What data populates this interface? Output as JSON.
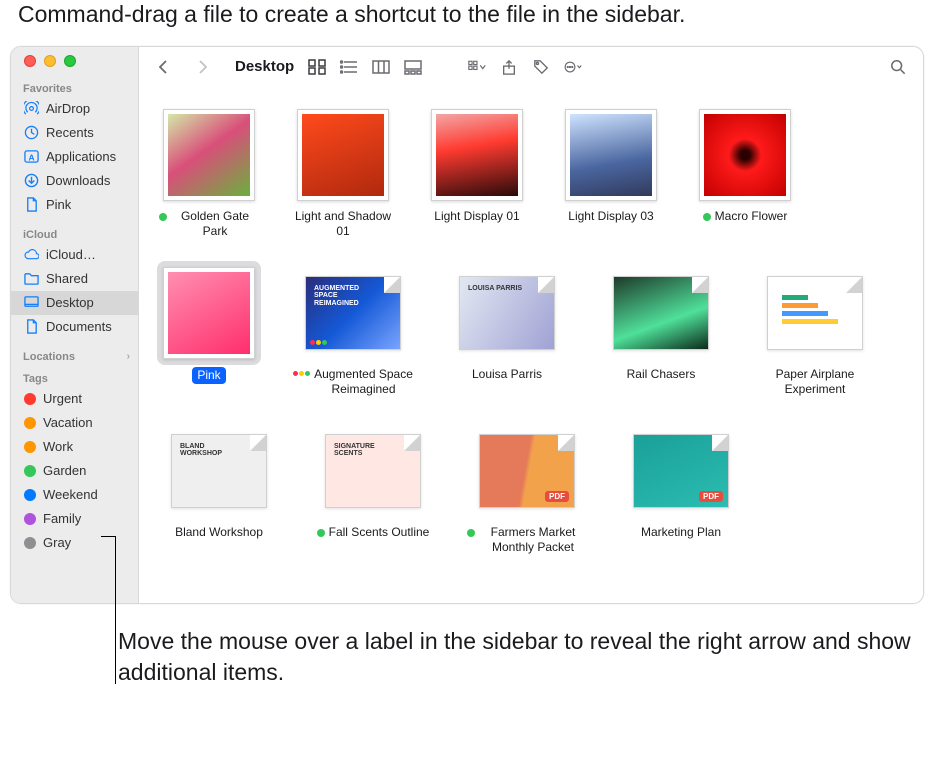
{
  "callouts": {
    "top": "Command-drag a file to create a shortcut to the file in the sidebar.",
    "bottom": "Move the mouse over a label in the sidebar to reveal the right arrow and show additional items."
  },
  "window": {
    "title": "Desktop"
  },
  "sidebar": {
    "favorites": {
      "header": "Favorites",
      "items": [
        {
          "label": "AirDrop",
          "icon": "airdrop-icon"
        },
        {
          "label": "Recents",
          "icon": "clock-icon"
        },
        {
          "label": "Applications",
          "icon": "app-icon"
        },
        {
          "label": "Downloads",
          "icon": "download-icon"
        },
        {
          "label": "Pink",
          "icon": "doc-icon"
        }
      ]
    },
    "icloud": {
      "header": "iCloud",
      "items": [
        {
          "label": "iCloud…",
          "icon": "cloud-icon"
        },
        {
          "label": "Shared",
          "icon": "folder-icon"
        },
        {
          "label": "Desktop",
          "icon": "desktop-icon",
          "selected": true
        },
        {
          "label": "Documents",
          "icon": "doc-icon"
        }
      ]
    },
    "locations": {
      "header": "Locations"
    },
    "tags": {
      "header": "Tags",
      "items": [
        {
          "label": "Urgent",
          "color": "#ff3b30"
        },
        {
          "label": "Vacation",
          "color": "#ff9500"
        },
        {
          "label": "Work",
          "color": "#ff9500"
        },
        {
          "label": "Garden",
          "color": "#34c759"
        },
        {
          "label": "Weekend",
          "color": "#007aff"
        },
        {
          "label": "Family",
          "color": "#af52de"
        },
        {
          "label": "Gray",
          "color": "#8e8e93"
        }
      ]
    }
  },
  "files": [
    {
      "label": "Golden Gate Park",
      "kind": "photo",
      "gradient": "linear-gradient(145deg,#d4e8a8,#d94f7a 45%,#6ab03d)",
      "tag": "#34c759"
    },
    {
      "label": "Light and Shadow 01",
      "kind": "photo",
      "gradient": "linear-gradient(160deg,#ff4a1c,#b0290e)"
    },
    {
      "label": "Light Display 01",
      "kind": "photo",
      "gradient": "linear-gradient(170deg,#f2a6a6,#ff3b30 40%,#2a0a0a)"
    },
    {
      "label": "Light Display 03",
      "kind": "photo",
      "gradient": "linear-gradient(170deg,#cfe3ff,#4a66a0 60%,#313a5c)"
    },
    {
      "label": "Macro Flower",
      "kind": "photo",
      "gradient": "radial-gradient(circle at 50% 50%,#2b0000 8%,#ff1a1a 28%,#c20000)",
      "tag": "#34c759"
    },
    {
      "label": "Pink",
      "kind": "photo",
      "gradient": "linear-gradient(150deg,#ff8fb1,#ff2e6c)",
      "selected": true
    },
    {
      "label": "Augmented Space Reimagined",
      "kind": "keynote",
      "gradient": "linear-gradient(135deg,#2a2d7c,#1458d6 50%,#7aa4ff)",
      "title_overlay": "AUGMENTED SPACE REIMAGINED"
    },
    {
      "label": "Louisa Parris",
      "kind": "doc",
      "gradient": "linear-gradient(120deg,#e2e8f2,#a0a2d4)",
      "title_overlay": "LOUISA PARRIS"
    },
    {
      "label": "Rail Chasers",
      "kind": "doc",
      "gradient": "linear-gradient(160deg,#1e3a2a,#4fe09a 60%,#0c2a1a)"
    },
    {
      "label": "Paper Airplane Experiment",
      "kind": "doc",
      "gradient": "linear-gradient(#ffffff,#ffffff)",
      "chart": true
    },
    {
      "label": "Bland Workshop",
      "kind": "doc",
      "gradient": "linear-gradient(#efefef,#efefef)",
      "title_overlay": "BLAND WORKSHOP"
    },
    {
      "label": "Fall Scents Outline",
      "kind": "doc",
      "gradient": "linear-gradient(#ffe8e4,#ffe8e4)",
      "tag": "#34c759",
      "title_overlay": "SIGNATURE SCENTS"
    },
    {
      "label": "Farmers Market Monthly Packet",
      "kind": "pdf",
      "gradient": "linear-gradient(100deg,#e57a5a 48%,#f2a24a 52%)",
      "tag": "#34c759"
    },
    {
      "label": "Marketing Plan",
      "kind": "pdf",
      "gradient": "linear-gradient(155deg,#1aa098,#2bbcb2)"
    }
  ]
}
